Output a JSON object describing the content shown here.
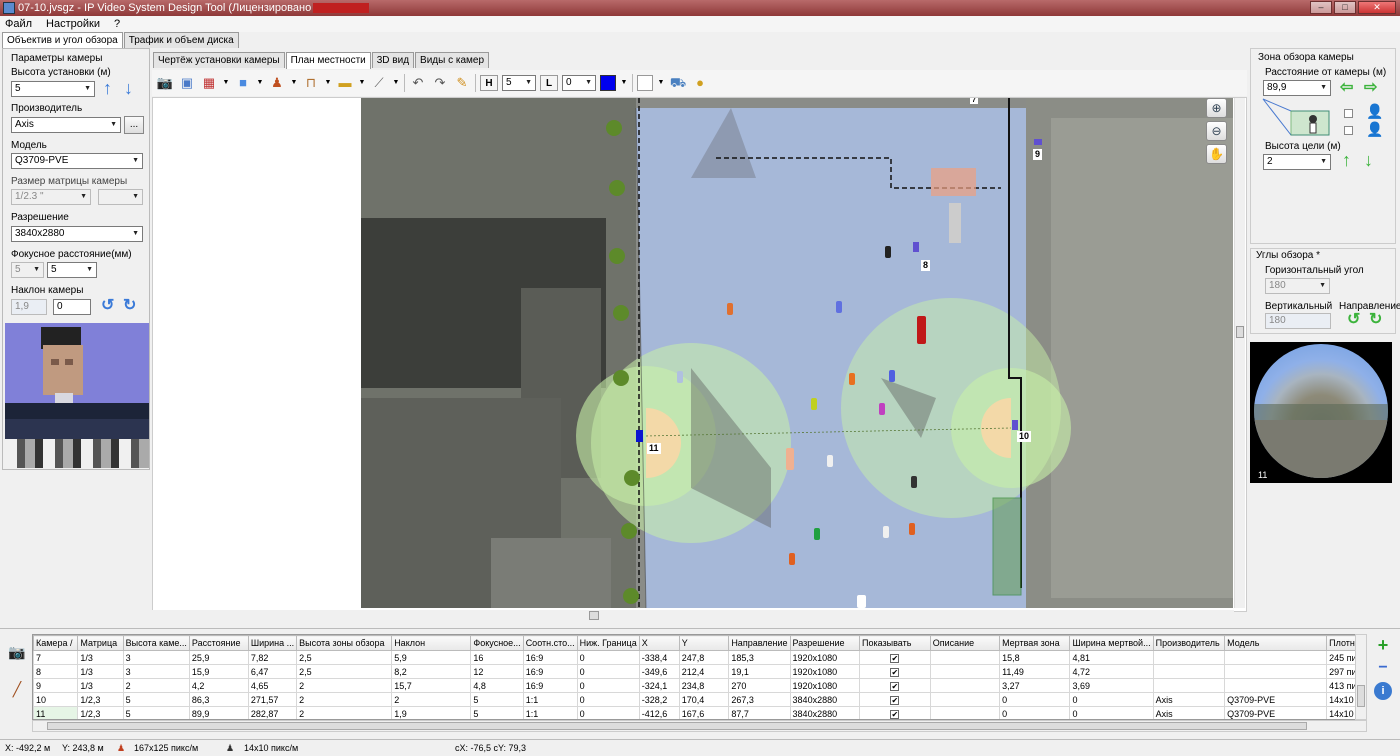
{
  "window": {
    "title": "07-10.jvsgz - IP Video System Design Tool (Лицензировано"
  },
  "menu": [
    "Файл",
    "Настройки",
    "?"
  ],
  "left_tabs": [
    "Объектив и угол обзора",
    "Трафик и объем диска"
  ],
  "left": {
    "section": "Параметры камеры",
    "height_label": "Высота установки (м)",
    "height_value": "5",
    "manufacturer_label": "Производитель",
    "manufacturer_value": "Axis",
    "more_button": "...",
    "model_label": "Модель",
    "model_value": "Q3709-PVE",
    "sensor_label": "Размер матрицы камеры",
    "sensor_value": "1/2.3 \"",
    "resolution_label": "Разрешение",
    "resolution_value": "3840x2880",
    "focal_label": "Фокусное расстояние(мм)",
    "focal_min": "5",
    "focal_value": "5",
    "tilt_label": "Наклон камеры",
    "tilt_value1": "1,9",
    "tilt_value2": "0"
  },
  "view_tabs": [
    "Чертёж установки камеры",
    "План местности",
    "3D вид",
    "Виды с камер"
  ],
  "toolbar": {
    "h_label": "H",
    "h_value": "5",
    "l_label": "L",
    "l_value": "0",
    "color": "#0000ee"
  },
  "map": {
    "camera_labels": [
      "9",
      "8",
      "10",
      "11",
      "7"
    ]
  },
  "right": {
    "zone_title": "Зона обзора камеры",
    "distance_label": "Расстояние от камеры (м)",
    "distance_value": "89,9",
    "target_height_label": "Высота цели (м)",
    "target_height_value": "2",
    "angles_title": "Углы обзора *",
    "horizontal_label": "Горизонтальный угол",
    "horizontal_value": "180",
    "vertical_label": "Вертикальный",
    "vertical_value": "180",
    "direction_label": "Направление",
    "preview_label": "11"
  },
  "table": {
    "headers": [
      "Камера /",
      "Матрица",
      "Высота каме...",
      "Расстояние",
      "Ширина ...",
      "Высота зоны обзора",
      "Наклон",
      "Фокусное...",
      "Соотн.сто...",
      "Ниж. Граница",
      "X",
      "Y",
      "Направление",
      "Разрешение",
      "Показывать",
      "Описание",
      "Мертвая зона",
      "Ширина мертвой...",
      "Производитель",
      "Модель",
      "Плотн"
    ],
    "rows": [
      [
        "7",
        "1/3",
        "3",
        "25,9",
        "7,82",
        "2,5",
        "5,9",
        "16",
        "16:9",
        "0",
        "-338,4",
        "247,8",
        "185,3",
        "1920x1080",
        "✔",
        "",
        "15,8",
        "4,81",
        "",
        "",
        "245 пи"
      ],
      [
        "8",
        "1/3",
        "3",
        "15,9",
        "6,47",
        "2,5",
        "8,2",
        "12",
        "16:9",
        "0",
        "-349,6",
        "212,4",
        "19,1",
        "1920x1080",
        "✔",
        "",
        "11,49",
        "4,72",
        "",
        "",
        "297 пи"
      ],
      [
        "9",
        "1/3",
        "2",
        "4,2",
        "4,65",
        "2",
        "15,7",
        "4,8",
        "16:9",
        "0",
        "-324,1",
        "234,8",
        "270",
        "1920x1080",
        "✔",
        "",
        "3,27",
        "3,69",
        "",
        "",
        "413 пи"
      ],
      [
        "10",
        "1/2,3",
        "5",
        "86,3",
        "271,57",
        "2",
        "2",
        "5",
        "1:1",
        "0",
        "-328,2",
        "170,4",
        "267,3",
        "3840x2880",
        "✔",
        "",
        "0",
        "0",
        "Axis",
        "Q3709-PVE",
        "14x10"
      ],
      [
        "11",
        "1/2,3",
        "5",
        "89,9",
        "282,87",
        "2",
        "1,9",
        "5",
        "1:1",
        "0",
        "-412,6",
        "167,6",
        "87,7",
        "3840x2880",
        "✔",
        "",
        "0",
        "0",
        "Axis",
        "Q3709-PVE",
        "14x10"
      ]
    ]
  },
  "status": {
    "x": "X: -492,2 м",
    "y": "Y: 243,8 м",
    "density1": "167x125 пикс/м",
    "density2": "14x10 пикс/м",
    "cxy": "cX: -76,5 cY: 79,3"
  }
}
